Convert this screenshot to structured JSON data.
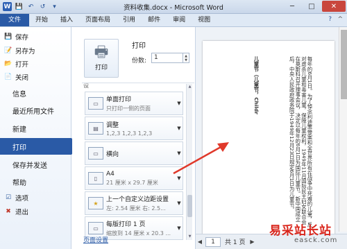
{
  "window": {
    "title": "资料收集.docx - Microsoft Word",
    "app_icon": "W",
    "minimize": "─",
    "maximize": "□",
    "close": "✕"
  },
  "quick_access": {
    "save_icon": "💾",
    "undo_icon": "↶",
    "redo_icon": "↺",
    "customize_icon": "▾"
  },
  "ribbon": {
    "tabs": [
      "文件",
      "开始",
      "插入",
      "页面布局",
      "引用",
      "邮件",
      "审阅",
      "视图"
    ],
    "help_icon": "?",
    "minimize_icon": "^"
  },
  "backstage_nav": {
    "small_items": [
      {
        "label": "保存",
        "icon": "💾"
      },
      {
        "label": "另存为",
        "icon": "📝"
      },
      {
        "label": "打开",
        "icon": "📂"
      },
      {
        "label": "关闭",
        "icon": "📄"
      }
    ],
    "big_items": [
      "信息",
      "最近所用文件",
      "新建",
      "打印",
      "保存并发送",
      "帮助"
    ],
    "active": "打印",
    "bottom_items": [
      {
        "label": "选项",
        "icon": "☑"
      },
      {
        "label": "退出",
        "icon": "✖"
      }
    ],
    "accent_color": "#2a5aa6"
  },
  "print_panel": {
    "heading": "打印",
    "print_button": "打印",
    "copies_label": "份数:",
    "copies_value": "1",
    "settings_cut": "设",
    "settings": [
      {
        "title": "单面打印",
        "sub": "只打印一侧的页面",
        "icon": "▭"
      },
      {
        "title": "调整",
        "sub": "1,2,3    1,2,3    1,2,3",
        "icon": "▤"
      },
      {
        "title": "横向",
        "sub": "",
        "icon": "▭"
      },
      {
        "title": "A4",
        "sub": "21 厘米 x 29.7 厘米",
        "icon": "▯"
      },
      {
        "title": "上一个自定义边距设置",
        "sub": "左: 2.54 厘米   右: 2.5...",
        "icon": "★"
      },
      {
        "title": "每版打印 1 页",
        "sub": "缩放到 14 厘米 x 20.3 ...",
        "icon": "▭"
      }
    ],
    "page_setup_link": "页面设置"
  },
  "preview": {
    "col1": "儿童节（儿童节，Childr",
    "col2": "每年的6月1日。为了悼念利迪策惨案和全世界所有在战争中死难的儿童，反对虐杀儿童和毒害儿童，保障儿童权利，1949年11月国际民主妇女联合会在莫斯科召开理事会议，决定以每年的6月1日为国际儿童节。新中国成立后，中央人民政府政务院于1949年12月23日规定6月1日为儿童节。",
    "page_current": "1",
    "page_total": "共 1 页",
    "prev": "◀",
    "next": "▶"
  },
  "watermark": {
    "line1": "易采站长站",
    "line2": "easck.com"
  },
  "colors": {
    "annotation_arrow": "#e0392b"
  }
}
